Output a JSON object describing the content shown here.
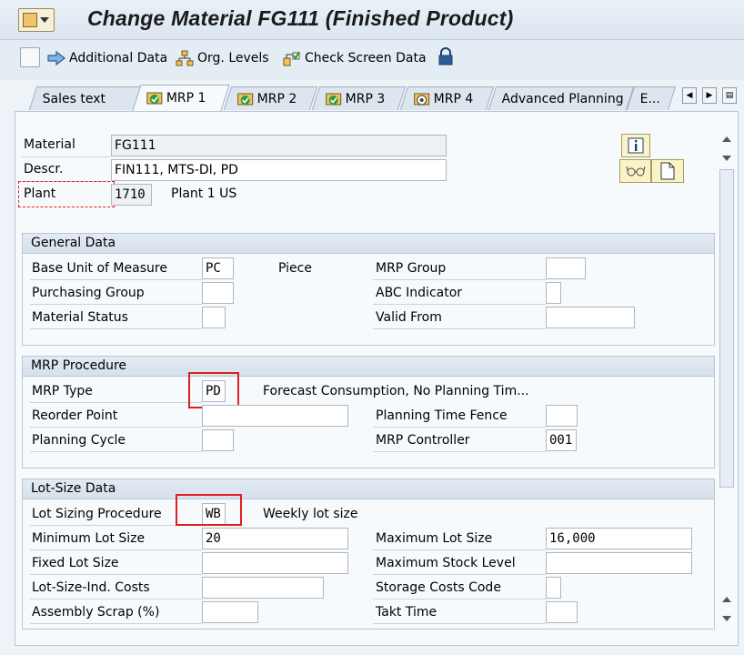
{
  "window": {
    "title": "Change Material FG111 (Finished Product)"
  },
  "toolbar": {
    "additional_data": "Additional Data",
    "org_levels": "Org. Levels",
    "check_screen_data": "Check Screen Data"
  },
  "tabs": [
    {
      "label": "Sales text",
      "icon": ""
    },
    {
      "label": "MRP 1",
      "icon": "check-ok-icon"
    },
    {
      "label": "MRP 2",
      "icon": "check-ok-icon"
    },
    {
      "label": "MRP 3",
      "icon": "check-ok-icon"
    },
    {
      "label": "MRP 4",
      "icon": "target-icon"
    },
    {
      "label": "Advanced Planning",
      "icon": ""
    },
    {
      "label": "E...",
      "icon": ""
    }
  ],
  "header": {
    "material_label": "Material",
    "material_value": "FG111",
    "descr_label": "Descr.",
    "descr_value": "FIN111, MTS-DI, PD",
    "plant_label": "Plant",
    "plant_value": "1710",
    "plant_text": "Plant 1 US"
  },
  "general_data": {
    "title": "General Data",
    "base_uom_label": "Base Unit of Measure",
    "base_uom_value": "PC",
    "base_uom_text": "Piece",
    "purchasing_group_label": "Purchasing Group",
    "purchasing_group_value": "",
    "material_status_label": "Material Status",
    "material_status_value": "",
    "mrp_group_label": "MRP Group",
    "mrp_group_value": "",
    "abc_indicator_label": "ABC Indicator",
    "abc_indicator_value": "",
    "valid_from_label": "Valid From",
    "valid_from_value": ""
  },
  "mrp_procedure": {
    "title": "MRP Procedure",
    "mrp_type_label": "MRP Type",
    "mrp_type_value": "PD",
    "mrp_type_text": "Forecast Consumption, No Planning Tim...",
    "reorder_point_label": "Reorder Point",
    "reorder_point_value": "",
    "planning_cycle_label": "Planning Cycle",
    "planning_cycle_value": "",
    "planning_time_fence_label": "Planning Time Fence",
    "planning_time_fence_value": "",
    "mrp_controller_label": "MRP Controller",
    "mrp_controller_value": "001"
  },
  "lot_size": {
    "title": "Lot-Size Data",
    "procedure_label": "Lot Sizing Procedure",
    "procedure_value": "WB",
    "procedure_text": "Weekly lot size",
    "min_lot_label": "Minimum Lot Size",
    "min_lot_value": "20",
    "fixed_lot_label": "Fixed Lot Size",
    "fixed_lot_value": "",
    "ind_costs_label": "Lot-Size-Ind. Costs",
    "ind_costs_value": "",
    "assembly_scrap_label": "Assembly Scrap (%)",
    "assembly_scrap_value": "",
    "max_lot_label": "Maximum Lot Size",
    "max_lot_value": "16,000",
    "max_stock_label": "Maximum Stock Level",
    "max_stock_value": "",
    "storage_costs_label": "Storage Costs Code",
    "storage_costs_value": "",
    "takt_time_label": "Takt Time",
    "takt_time_value": ""
  },
  "colors": {
    "highlight": "#e01f1f",
    "group_header": "#d6e1ec",
    "panel": "#f7fafc"
  }
}
